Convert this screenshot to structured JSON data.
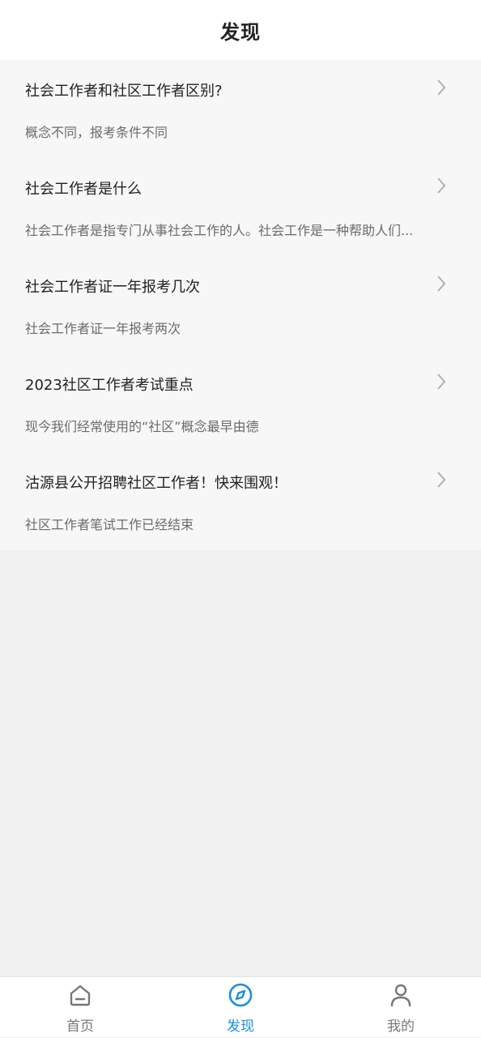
{
  "header": {
    "title": "发现"
  },
  "articles": [
    {
      "title": "社会工作者和社区工作者区别?",
      "summary": "概念不同，报考条件不同"
    },
    {
      "title": "社会工作者是什么",
      "summary": "社会工作者是指专门从事社会工作的人。社会工作是一种帮助人们..."
    },
    {
      "title": "社会工作者证一年报考几次",
      "summary": "社会工作者证一年报考两次"
    },
    {
      "title": "2023社区工作者考试重点",
      "summary": "现今我们经常使用的“社区”概念最早由德"
    },
    {
      "title": "沽源县公开招聘社区工作者！快来围观！",
      "summary": "社区工作者笔试工作已经结束"
    }
  ],
  "tabbar": {
    "tabs": [
      {
        "label": "首页",
        "icon": "home-icon",
        "active": false
      },
      {
        "label": "发现",
        "icon": "compass-icon",
        "active": true
      },
      {
        "label": "我的",
        "icon": "person-icon",
        "active": false
      }
    ],
    "active_color": "#1a8ee5",
    "inactive_color": "#777777"
  }
}
